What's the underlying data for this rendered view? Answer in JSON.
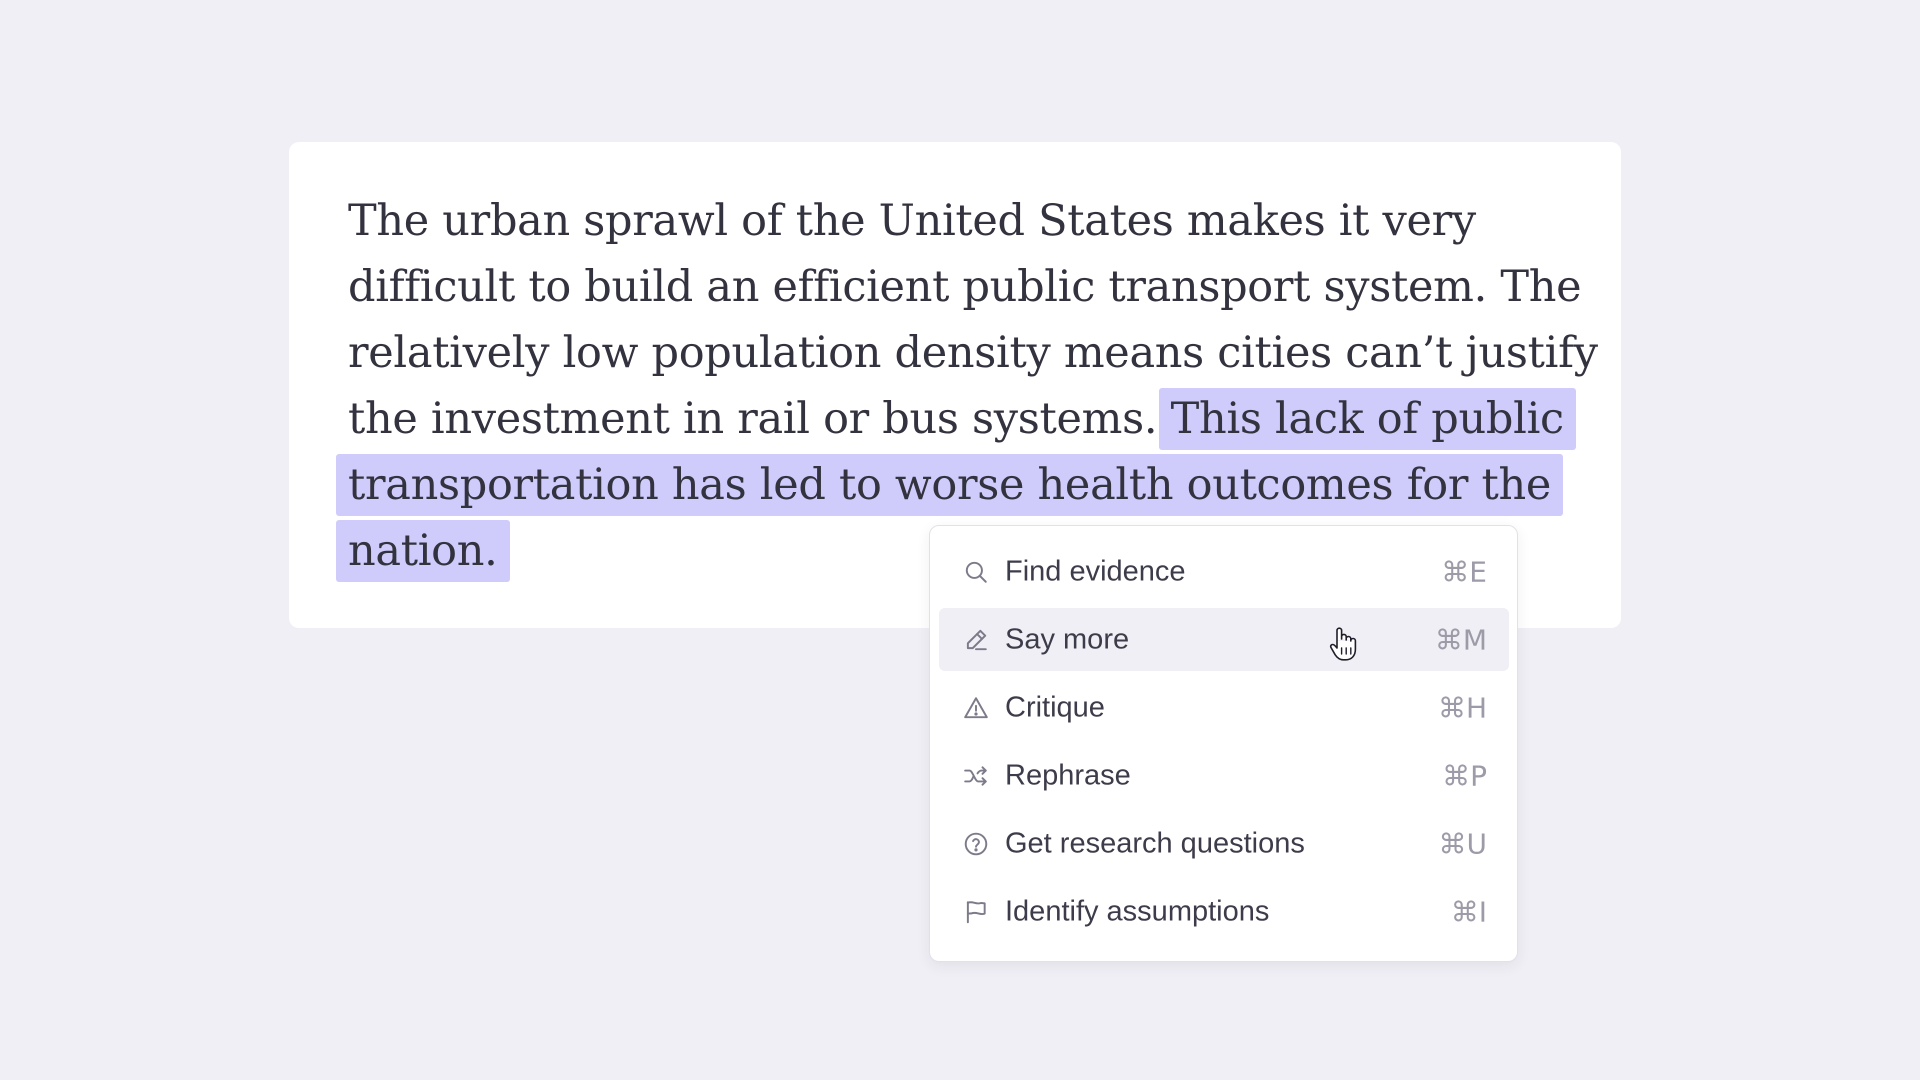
{
  "document": {
    "text_plain": "The urban sprawl of the United States makes it very difficult to build an efficient public transport system. The relatively low population density means cities can’t justify the investment in rail or bus systems. ",
    "text_selected": "This lack of public transportation has led to worse health outcomes for the nation.",
    "selection_color": "#cfccfb"
  },
  "menu": {
    "items": [
      {
        "label": "Find evidence",
        "shortcut": "⌘E",
        "icon": "search-icon"
      },
      {
        "label": "Say more",
        "shortcut": "⌘M",
        "icon": "pencil-icon"
      },
      {
        "label": "Critique",
        "shortcut": "⌘H",
        "icon": "warning-triangle-icon"
      },
      {
        "label": "Rephrase",
        "shortcut": "⌘P",
        "icon": "shuffle-icon"
      },
      {
        "label": "Get research questions",
        "shortcut": "⌘U",
        "icon": "question-circle-icon"
      },
      {
        "label": "Identify assumptions",
        "shortcut": "⌘I",
        "icon": "flag-icon"
      }
    ],
    "hovered_item": "Say more"
  }
}
